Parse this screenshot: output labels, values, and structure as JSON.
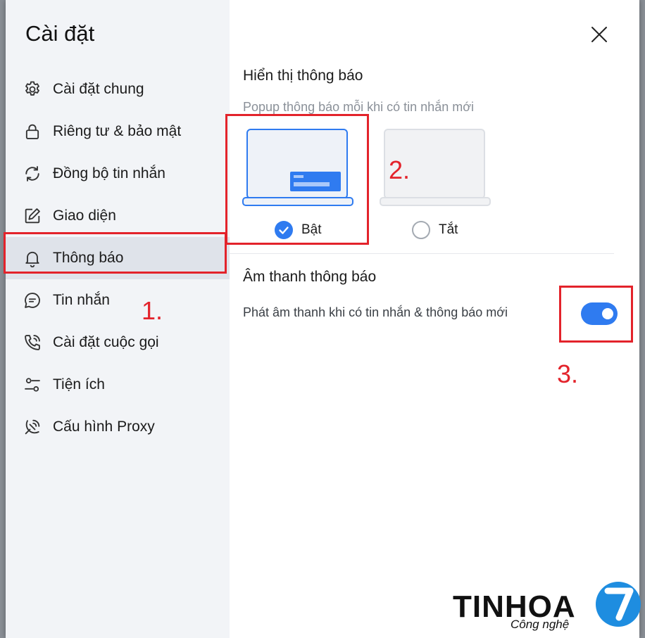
{
  "sidebar": {
    "title": "Cài đặt",
    "items": [
      {
        "label": "Cài đặt chung",
        "icon": "gear-icon",
        "active": false
      },
      {
        "label": "Riêng tư & bảo mật",
        "icon": "lock-icon",
        "active": false
      },
      {
        "label": "Đồng bộ tin nhắn",
        "icon": "sync-icon",
        "active": false
      },
      {
        "label": "Giao diện",
        "icon": "edit-icon",
        "active": false
      },
      {
        "label": "Thông báo",
        "icon": "bell-icon",
        "active": true
      },
      {
        "label": "Tin nhắn",
        "icon": "chat-icon",
        "active": false
      },
      {
        "label": "Cài đặt cuộc gọi",
        "icon": "phone-icon",
        "active": false
      },
      {
        "label": "Tiện ích",
        "icon": "sliders-icon",
        "active": false
      },
      {
        "label": "Cấu hình Proxy",
        "icon": "proxy-icon",
        "active": false
      }
    ]
  },
  "notifications": {
    "display_title": "Hiển thị thông báo",
    "display_desc": "Popup thông báo mỗi khi có tin nhắn mới",
    "options": [
      {
        "label": "Bật",
        "selected": true
      },
      {
        "label": "Tắt",
        "selected": false
      }
    ],
    "sound_title": "Âm thanh thông báo",
    "sound_desc": "Phát âm thanh khi có tin nhắn & thông báo mới",
    "sound_enabled": true
  },
  "annotations": {
    "n1": "1.",
    "n2": "2.",
    "n3": "3."
  },
  "watermark": {
    "brand": "TINHOA",
    "sub": "Công nghệ",
    "logo_digit": "7"
  },
  "colors": {
    "accent": "#2f7bf0",
    "annotation": "#e3232b",
    "sidebar_bg": "#f2f4f7",
    "active_item_bg": "#dfe3ea"
  }
}
